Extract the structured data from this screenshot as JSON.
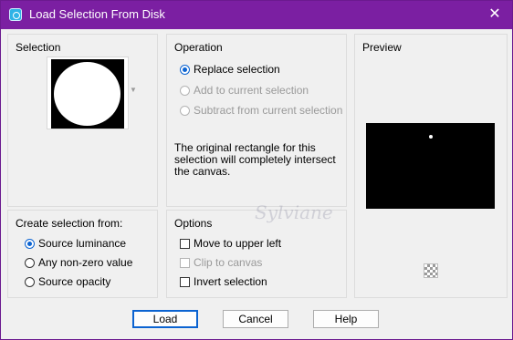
{
  "window": {
    "title": "Load Selection From Disk",
    "title_icon": "selection-dialog-icon",
    "close_icon": "close-icon",
    "accent": "#7b1fa2"
  },
  "selection": {
    "title": "Selection",
    "thumbnail_icon": "selection-mask-thumbnail"
  },
  "operation": {
    "title": "Operation",
    "options": [
      {
        "label": "Replace selection",
        "checked": true,
        "enabled": true
      },
      {
        "label": "Add to current selection",
        "checked": false,
        "enabled": false
      },
      {
        "label": "Subtract from current selection",
        "checked": false,
        "enabled": false
      }
    ],
    "info_text": "The original rectangle for this selection will completely intersect the canvas."
  },
  "preview": {
    "title": "Preview",
    "checker_icon": "transparency-checkerboard-icon"
  },
  "create_from": {
    "title": "Create selection from:",
    "options": [
      {
        "label": "Source luminance",
        "checked": true
      },
      {
        "label": "Any non-zero value",
        "checked": false
      },
      {
        "label": "Source opacity",
        "checked": false
      }
    ]
  },
  "options": {
    "title": "Options",
    "items": [
      {
        "label": "Move to upper left",
        "checked": false,
        "enabled": true
      },
      {
        "label": "Clip to canvas",
        "checked": false,
        "enabled": false
      },
      {
        "label": "Invert selection",
        "checked": false,
        "enabled": true
      }
    ]
  },
  "buttons": {
    "load": "Load",
    "cancel": "Cancel",
    "help": "Help"
  },
  "watermark": "Sylviane"
}
